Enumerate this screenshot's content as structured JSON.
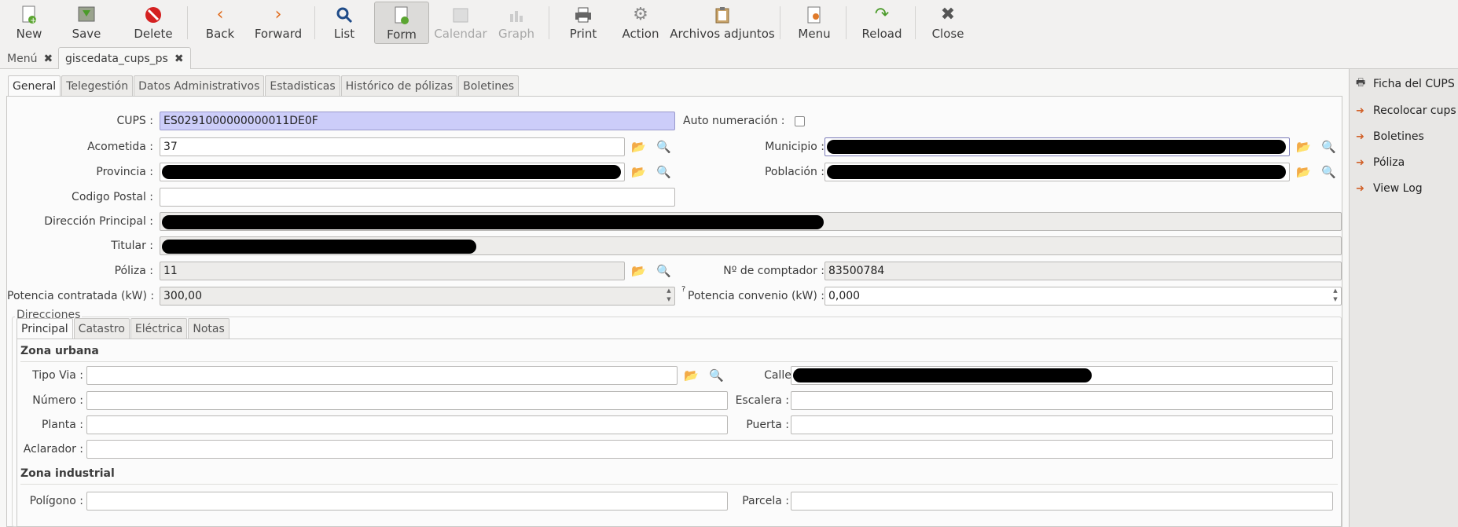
{
  "toolbar": {
    "new": "New",
    "save": "Save",
    "delete": "Delete",
    "back": "Back",
    "forward": "Forward",
    "list": "List",
    "form": "Form",
    "calendar": "Calendar",
    "graph": "Graph",
    "print": "Print",
    "action": "Action",
    "attachments": "Archivos adjuntos",
    "menu": "Menu",
    "reload": "Reload",
    "close": "Close"
  },
  "doc_tabs": [
    {
      "label": "Menú"
    },
    {
      "label": "giscedata_cups_ps"
    }
  ],
  "form_tabs": [
    "General",
    "Telegestión",
    "Datos Administrativos",
    "Estadisticas",
    "Histórico de pólizas",
    "Boletines"
  ],
  "form": {
    "cups_label": "CUPS :",
    "cups_value": "ES0291000000000011DE0F",
    "auto_num_label": "Auto numeración :",
    "acometida_label": "Acometida :",
    "acometida_value": "37",
    "municipio_label": "Municipio :",
    "provincia_label": "Provincia :",
    "poblacion_label": "Población :",
    "cp_label": "Codigo Postal :",
    "direccion_label": "Dirección Principal :",
    "titular_label": "Titular :",
    "poliza_label": "Póliza :",
    "poliza_value": "11",
    "comptador_label": "Nº de comptador :",
    "comptador_value": "83500784",
    "potencia_label": "Potencia contratada (kW) :",
    "potencia_value": "300,00",
    "potencia_conv_label": "Potencia convenio (kW) :",
    "potencia_conv_help": "?",
    "potencia_conv_value": "0,000"
  },
  "direcciones": {
    "title": "Direcciones",
    "tabs": [
      "Principal",
      "Catastro",
      "Eléctrica",
      "Notas"
    ],
    "urbana_title": "Zona urbana",
    "tipo_via_label": "Tipo Via :",
    "calle_label": "Calle :",
    "numero_label": "Número :",
    "escalera_label": "Escalera :",
    "planta_label": "Planta :",
    "puerta_label": "Puerta :",
    "aclarador_label": "Aclarador :",
    "industrial_title": "Zona industrial",
    "poligono_label": "Polígono :",
    "parcela_label": "Parcela :"
  },
  "sidebar": {
    "items": [
      "Ficha del CUPS",
      "Recolocar cups",
      "Boletines",
      "Póliza",
      "View Log"
    ]
  }
}
